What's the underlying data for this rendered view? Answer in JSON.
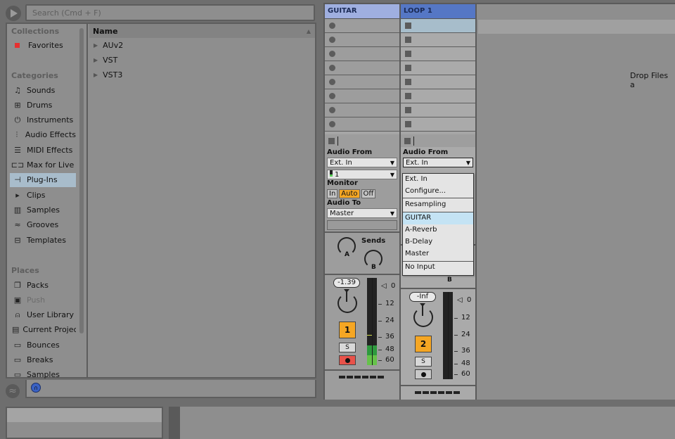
{
  "browser": {
    "search_placeholder": "Search (Cmd + F)",
    "collections_heading": "Collections",
    "favorites_label": "Favorites",
    "favorites_color": "#e63030",
    "categories_heading": "Categories",
    "categories": [
      {
        "label": "Sounds",
        "icon": "music-note-icon"
      },
      {
        "label": "Drums",
        "icon": "grid-icon"
      },
      {
        "label": "Instruments",
        "icon": "power-knob-icon"
      },
      {
        "label": "Audio Effects",
        "icon": "waveform-icon"
      },
      {
        "label": "MIDI Effects",
        "icon": "midi-lines-icon"
      },
      {
        "label": "Max for Live",
        "icon": "max-icon"
      },
      {
        "label": "Plug-Ins",
        "icon": "plug-icon",
        "selected": true
      },
      {
        "label": "Clips",
        "icon": "clip-play-icon"
      },
      {
        "label": "Samples",
        "icon": "sample-wave-icon"
      },
      {
        "label": "Grooves",
        "icon": "groove-wave-icon"
      },
      {
        "label": "Templates",
        "icon": "template-icon"
      }
    ],
    "places_heading": "Places",
    "places": [
      {
        "label": "Packs",
        "icon": "packs-icon"
      },
      {
        "label": "Push",
        "icon": "push-icon",
        "dimmed": true
      },
      {
        "label": "User Library",
        "icon": "user-icon"
      },
      {
        "label": "Current Project",
        "icon": "project-folder-icon"
      },
      {
        "label": "Bounces",
        "icon": "folder-icon"
      },
      {
        "label": "Breaks",
        "icon": "folder-icon"
      },
      {
        "label": "Samples",
        "icon": "folder-icon"
      }
    ],
    "list_header": "Name",
    "list_items": [
      "AUv2",
      "VST",
      "VST3"
    ]
  },
  "session": {
    "drop_hint": "Drop Files a",
    "tracks": [
      {
        "name": "GUITAR",
        "header_color": "#9fafe0",
        "audio_from_label": "Audio From",
        "audio_from_value": "Ext. In",
        "input_channel": "1",
        "monitor_label": "Monitor",
        "monitor_options": [
          "In",
          "Auto",
          "Off"
        ],
        "monitor_active": "Auto",
        "audio_to_label": "Audio To",
        "audio_to_value": "Master",
        "sends_label": "Sends",
        "send_a": "A",
        "send_b": "B",
        "volume": "-1.39",
        "track_number": "1",
        "solo_label": "S",
        "armed": true
      },
      {
        "name": "LOOP 1",
        "header_color": "#5577c5",
        "audio_from_label": "Audio From",
        "audio_from_value": "Ext. In",
        "volume": "-Inf",
        "track_number": "2",
        "solo_label": "S",
        "armed": false,
        "send_b": "B"
      }
    ],
    "meter_scale": [
      "0",
      "12",
      "24",
      "36",
      "48",
      "60"
    ],
    "dropdown": {
      "items": [
        "Ext. In",
        "Configure...",
        "Resampling",
        "GUITAR",
        "A-Reverb",
        "B-Delay",
        "Master",
        "No Input"
      ],
      "highlighted": "GUITAR"
    }
  }
}
